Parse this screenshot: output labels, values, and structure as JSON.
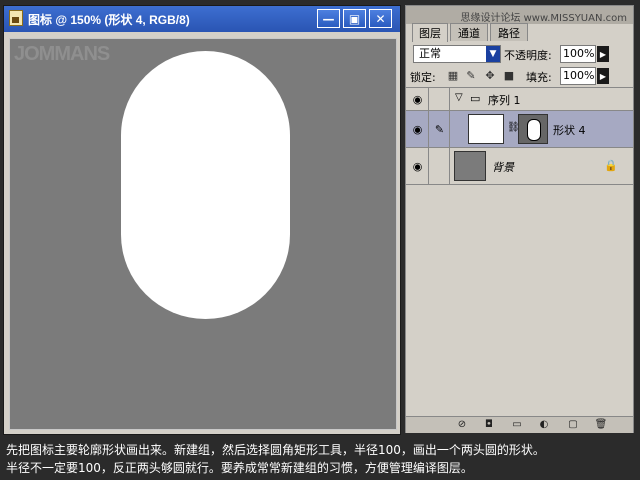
{
  "document_window": {
    "title": "图标 @ 150% (形状 4, RGB/8)",
    "buttons": {
      "minimize": "—",
      "restore": "▣",
      "close": "✕"
    },
    "watermark": "JOMMANS",
    "shape_color": "#ffffff",
    "canvas_color": "#7b7b7b"
  },
  "layers_panel": {
    "tabs": [
      "图层",
      "通道",
      "路径"
    ],
    "site_mark": "思缘设计论坛 www.MISSYUAN.com",
    "blend_mode": "正常",
    "opacity_label": "不透明度:",
    "opacity_value": "100%",
    "lock_label": "锁定:",
    "fill_label": "填充:",
    "fill_value": "100%",
    "layers": [
      {
        "name": "序列 1",
        "kind": "group"
      },
      {
        "name": "形状 4",
        "kind": "shape",
        "selected": true
      },
      {
        "name": "背景",
        "kind": "background",
        "locked": true
      }
    ]
  },
  "caption": {
    "line1": "先把图标主要轮廓形状画出来。新建组，然后选择圆角矩形工具，半径100，画出一个两头圆的形状。",
    "line2": "半径不一定要100，反正两头够圆就行。要养成常常新建组的习惯，方便管理编译图层。"
  },
  "colors": {
    "titlebar": "#2a55b3",
    "selected_layer": "#a6a9c2",
    "background": "#2b2b2b"
  }
}
